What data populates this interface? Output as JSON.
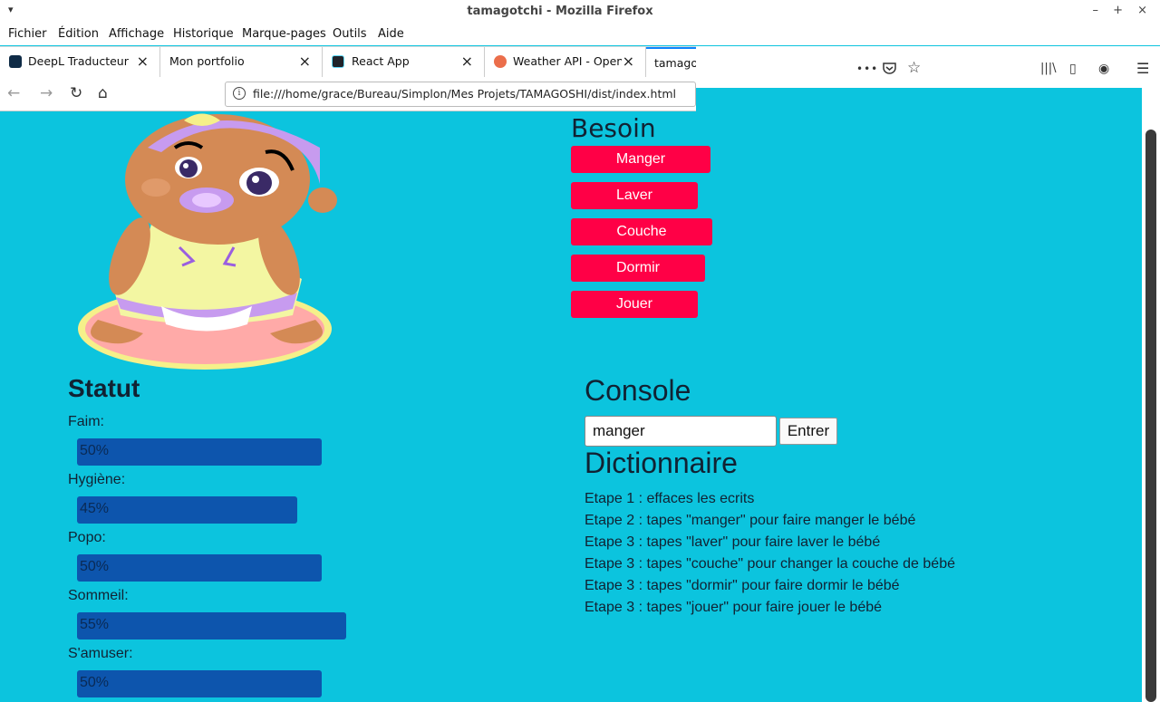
{
  "window": {
    "title": "tamagotchi - Mozilla Firefox",
    "menu_glyph": "▾",
    "controls": "–  +  ×"
  },
  "menubar": [
    "Fichier",
    "Édition",
    "Affichage",
    "Historique",
    "Marque-pages",
    "Outils",
    "Aide"
  ],
  "tabs": [
    {
      "label": "DeepL Traducteur",
      "close": "×"
    },
    {
      "label": "Mon portfolio",
      "close": "×"
    },
    {
      "label": "React App",
      "close": "×"
    },
    {
      "label": "Weather API - OpenW",
      "close": "×"
    },
    {
      "label": "tamagot",
      "close": ""
    }
  ],
  "nav": {
    "back": "←",
    "forward": "→",
    "reload": "↻",
    "home": "⌂",
    "url": "file:///home/grace/Bureau/Simplon/Mes Projets/TAMAGOSHI/dist/index.html",
    "more_icon": "•••",
    "pocket_icon": "pocket-icon",
    "star_icon": "☆",
    "library_icon": "|||\\",
    "sidebar_icon": "▯",
    "account_icon": "◉",
    "hamburger_icon": "☰"
  },
  "besoin": {
    "title": "Besoin",
    "buttons": [
      "Manger",
      "Laver",
      "Couche",
      "Dormir",
      "Jouer"
    ],
    "button_color": "#ff0046"
  },
  "statut": {
    "title": "Statut",
    "items": [
      {
        "label": "Faim:",
        "value": "50%",
        "level": 50
      },
      {
        "label": "Hygiène:",
        "value": "45%",
        "level": 45
      },
      {
        "label": "Popo:",
        "value": "50%",
        "level": 50
      },
      {
        "label": "Sommeil:",
        "value": "55%",
        "level": 55
      },
      {
        "label": "S'amuser:",
        "value": "50%",
        "level": 50
      }
    ],
    "bar_color": "#0d55ad"
  },
  "console": {
    "title": "Console",
    "input_value": "manger",
    "enter_label": "Entrer"
  },
  "dictionnaire": {
    "title": "Dictionnaire",
    "lines": [
      "Etape 1 : effaces les ecrits",
      "Etape 2 : tapes \"manger\" pour faire manger le bébé",
      "Etape 3 : tapes \"laver\" pour faire laver le bébé",
      "Etape 3 : tapes \"couche\" pour changer la couche de bébé",
      "Etape 3 : tapes \"dormir\" pour faire dormir le bébé",
      "Etape 3 : tapes \"jouer\" pour faire jouer le bébé"
    ]
  },
  "colors": {
    "page_background": "#0cc4de",
    "accent_tab": "#0a84ff"
  }
}
